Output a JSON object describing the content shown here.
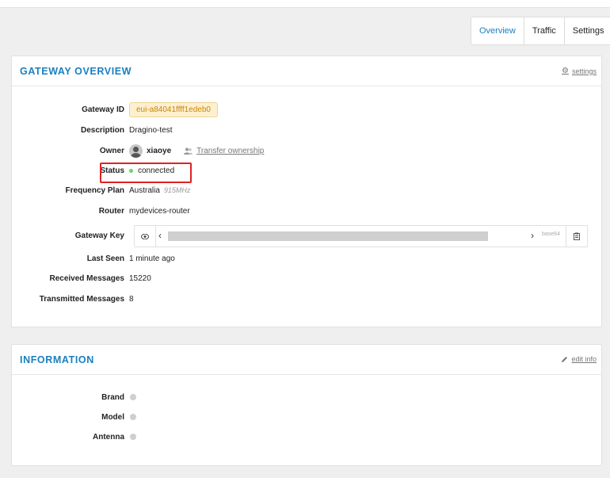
{
  "tabs": [
    {
      "label": "Overview"
    },
    {
      "label": "Traffic"
    },
    {
      "label": "Settings"
    }
  ],
  "gateway_overview": {
    "title": "GATEWAY OVERVIEW",
    "settings_link": "settings",
    "fields": {
      "gateway_id": {
        "label": "Gateway ID",
        "value": "eui-a84041ffff1edeb0"
      },
      "description": {
        "label": "Description",
        "value": "Dragino-test"
      },
      "owner": {
        "label": "Owner",
        "value": "xiaoye",
        "transfer_label": "Transfer ownership"
      },
      "status": {
        "label": "Status",
        "value": "connected"
      },
      "frequency_plan": {
        "label": "Frequency Plan",
        "value": "Australia",
        "note": "915MHz"
      },
      "router": {
        "label": "Router",
        "value": "mydevices-router"
      },
      "gateway_key": {
        "label": "Gateway Key",
        "encoding": "base64"
      },
      "last_seen": {
        "label": "Last Seen",
        "value": "1 minute ago"
      },
      "received_messages": {
        "label": "Received Messages",
        "value": "15220"
      },
      "transmitted_messages": {
        "label": "Transmitted Messages",
        "value": "8"
      }
    }
  },
  "information": {
    "title": "INFORMATION",
    "edit_link": "edit info",
    "fields": {
      "brand": {
        "label": "Brand"
      },
      "model": {
        "label": "Model"
      },
      "antenna": {
        "label": "Antenna"
      }
    }
  },
  "colors": {
    "accent": "#1a7fc1",
    "status_connected": "#69d66e",
    "highlight_box": "#e02222",
    "id_pill_bg": "#fdf0cf"
  }
}
